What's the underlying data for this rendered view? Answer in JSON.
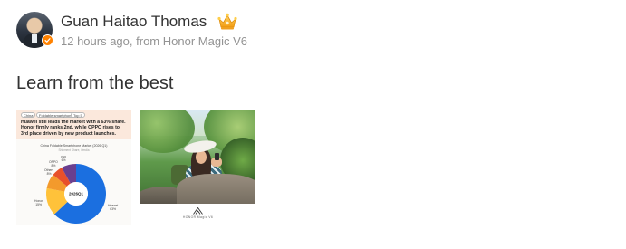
{
  "post": {
    "author": {
      "name": "Guan Haitao Thomas",
      "verified_badge_color": "#ff8200",
      "icon": "avatar-photo",
      "badge_icon": "crown-icon"
    },
    "meta": {
      "time": "12 hours ago,",
      "from_label": "from",
      "device": "Honor Magic V6"
    },
    "text": "Learn from the best",
    "images": [
      {
        "type": "infographic",
        "chips": [
          "China",
          "Foldable smartphones",
          "Top 5"
        ],
        "headline": "Huawei still leads the market with a 63% share. Honor firmly ranks 2nd, while OPPO rises to 3rd place driven by new product launches.",
        "chart_title": "China Foldable Smartphone Market (2026 Q1)",
        "chart_subtitle": "Shipment Share, Omdia",
        "center_label": "2026Q1",
        "chart_data": {
          "type": "pie",
          "title": "China Foldable Smartphone Market (2026 Q1)",
          "categories": [
            "Huawei",
            "Honor",
            "OPPO",
            "vivo",
            "Others"
          ],
          "values": [
            63,
            15,
            8,
            6,
            8
          ],
          "colors": [
            "#1b6fe0",
            "#ffc23a",
            "#f39a2c",
            "#e8502a",
            "#6a3f8f"
          ]
        },
        "labels": {
          "huawei": "Huawei\n63%",
          "honor": "Honor\n15%",
          "oppo": "OPPO\n8%",
          "vivo": "vivo\n6%",
          "others": "Others\n8%"
        }
      },
      {
        "type": "photo",
        "caption": "HONOR Magic V6",
        "icon": "honor-logo-icon"
      }
    ]
  },
  "colors": {
    "text": "#333333",
    "meta": "#939393",
    "background": "#ffffff"
  }
}
